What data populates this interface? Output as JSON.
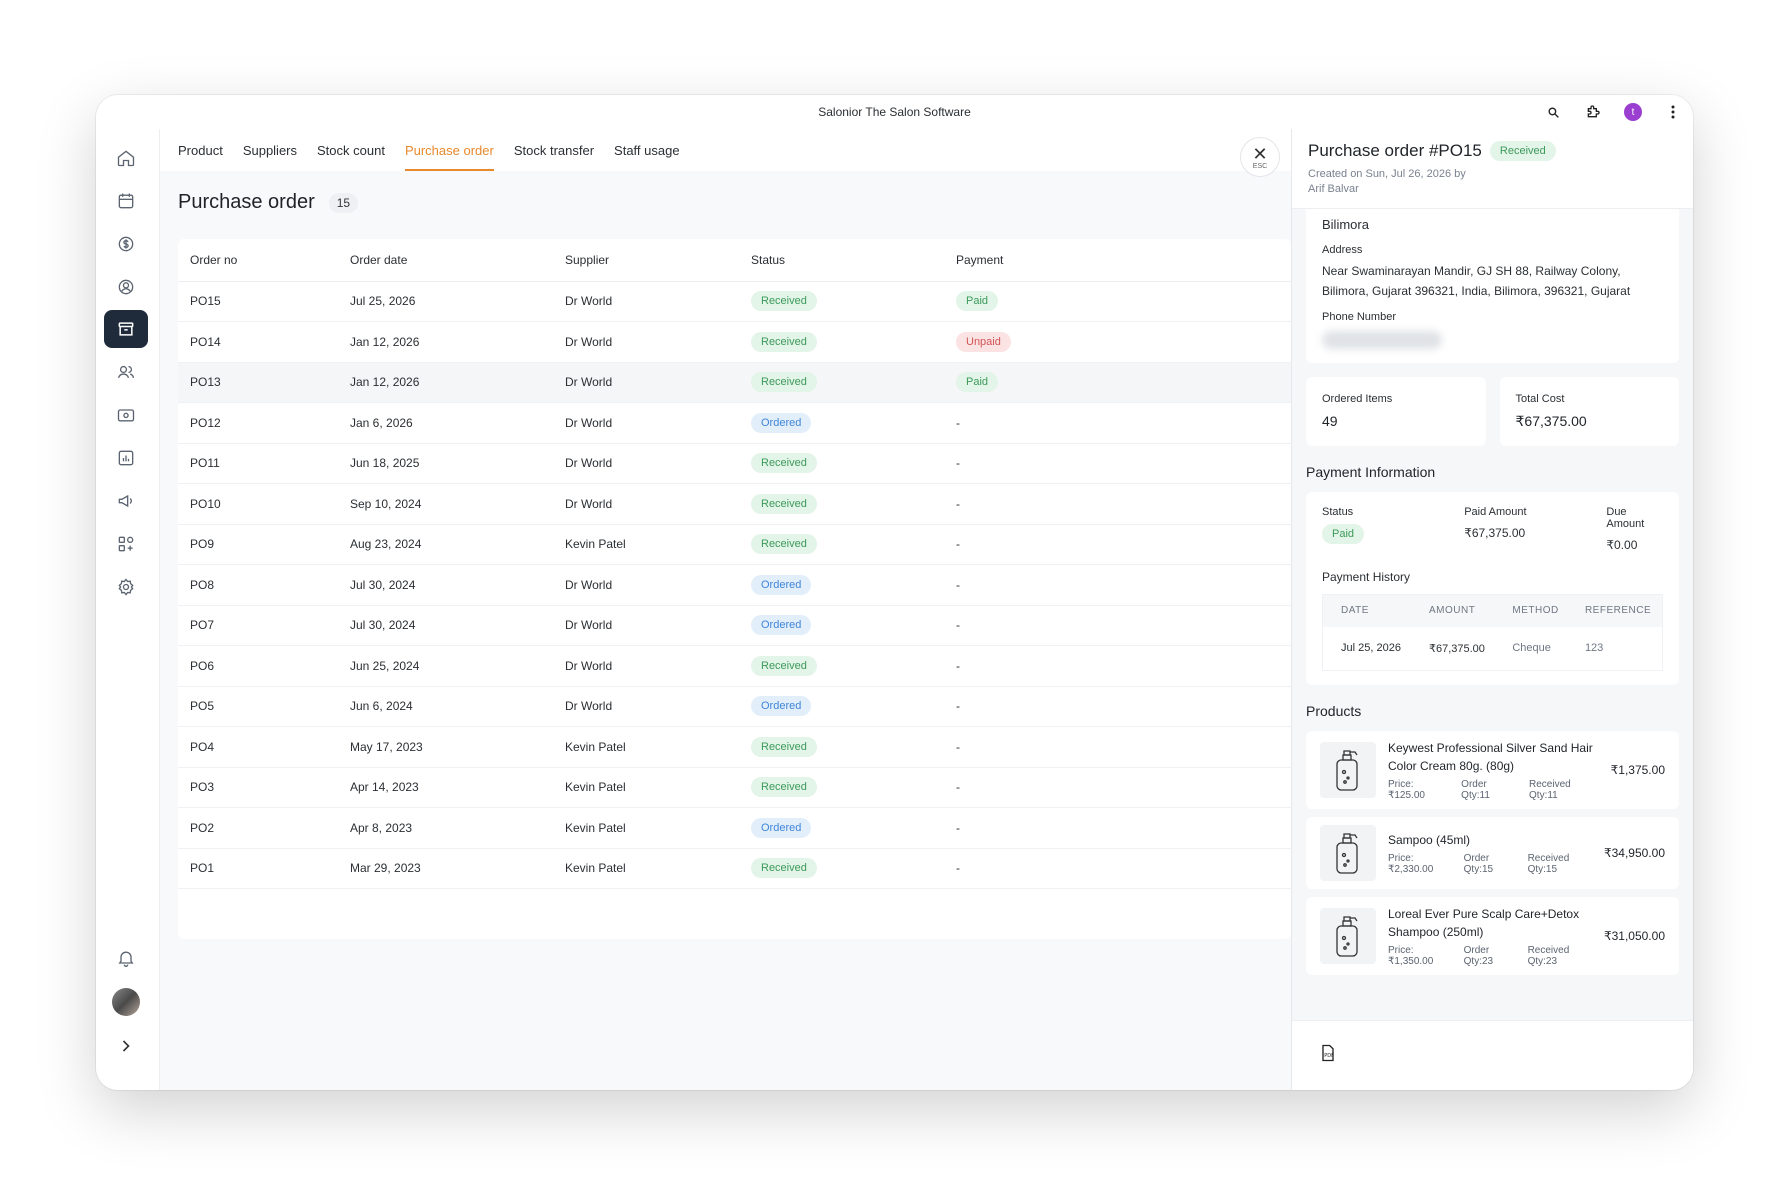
{
  "window": {
    "title": "Salonior The Salon Software"
  },
  "titlebar": {
    "avatar_letter": "t",
    "icons": [
      "search-icon",
      "extension-icon",
      "more-vertical-icon"
    ]
  },
  "sidebar": {
    "items": [
      {
        "name": "home-icon"
      },
      {
        "name": "calendar-icon"
      },
      {
        "name": "billing-icon"
      },
      {
        "name": "client-icon"
      },
      {
        "name": "inventory-icon"
      },
      {
        "name": "staff-icon"
      },
      {
        "name": "wallet-icon"
      },
      {
        "name": "reports-icon"
      },
      {
        "name": "marketing-icon"
      },
      {
        "name": "apps-icon"
      },
      {
        "name": "settings-icon"
      }
    ],
    "bottom": [
      "bell-icon",
      "user-avatar",
      "chevron-right-icon"
    ]
  },
  "tabs": [
    {
      "label": "Product",
      "active": false
    },
    {
      "label": "Suppliers",
      "active": false
    },
    {
      "label": "Stock count",
      "active": false
    },
    {
      "label": "Purchase order",
      "active": true
    },
    {
      "label": "Stock transfer",
      "active": false
    },
    {
      "label": "Staff usage",
      "active": false
    }
  ],
  "esc": {
    "label": "ESC"
  },
  "page": {
    "title": "Purchase order",
    "count": "15"
  },
  "table": {
    "columns": [
      "Order no",
      "Order date",
      "Supplier",
      "Status",
      "Payment"
    ],
    "rows": [
      {
        "order": "PO15",
        "date": "Jul 25, 2026",
        "supplier": "Dr World",
        "status": "Received",
        "payment": "Paid"
      },
      {
        "order": "PO14",
        "date": "Jan 12, 2026",
        "supplier": "Dr World",
        "status": "Received",
        "payment": "Unpaid"
      },
      {
        "order": "PO13",
        "date": "Jan 12, 2026",
        "supplier": "Dr World",
        "status": "Received",
        "payment": "Paid"
      },
      {
        "order": "PO12",
        "date": "Jan 6, 2026",
        "supplier": "Dr World",
        "status": "Ordered",
        "payment": "-"
      },
      {
        "order": "PO11",
        "date": "Jun 18, 2025",
        "supplier": "Dr World",
        "status": "Received",
        "payment": "-"
      },
      {
        "order": "PO10",
        "date": "Sep 10, 2024",
        "supplier": "Dr World",
        "status": "Received",
        "payment": "-"
      },
      {
        "order": "PO9",
        "date": "Aug 23, 2024",
        "supplier": "Kevin Patel",
        "status": "Received",
        "payment": "-"
      },
      {
        "order": "PO8",
        "date": "Jul 30, 2024",
        "supplier": "Dr World",
        "status": "Ordered",
        "payment": "-"
      },
      {
        "order": "PO7",
        "date": "Jul 30, 2024",
        "supplier": "Dr World",
        "status": "Ordered",
        "payment": "-"
      },
      {
        "order": "PO6",
        "date": "Jun 25, 2024",
        "supplier": "Dr World",
        "status": "Received",
        "payment": "-"
      },
      {
        "order": "PO5",
        "date": "Jun 6, 2024",
        "supplier": "Dr World",
        "status": "Ordered",
        "payment": "-"
      },
      {
        "order": "PO4",
        "date": "May 17, 2023",
        "supplier": "Kevin Patel",
        "status": "Received",
        "payment": "-"
      },
      {
        "order": "PO3",
        "date": "Apr 14, 2023",
        "supplier": "Kevin Patel",
        "status": "Received",
        "payment": "-"
      },
      {
        "order": "PO2",
        "date": "Apr 8, 2023",
        "supplier": "Kevin Patel",
        "status": "Ordered",
        "payment": "-"
      },
      {
        "order": "PO1",
        "date": "Mar 29, 2023",
        "supplier": "Kevin Patel",
        "status": "Received",
        "payment": "-"
      }
    ]
  },
  "panel": {
    "title": "Purchase order #PO15",
    "status": "Received",
    "created_line1": "Created on Sun, Jul 26, 2026 by",
    "created_line2": "Arif Balvar",
    "supplier_city": "Bilimora",
    "address_label": "Address",
    "address": "Near Swaminarayan Mandir, GJ SH 88, Railway Colony, Bilimora, Gujarat 396321, India, Bilimora, 396321, Gujarat",
    "phone_label": "Phone Number",
    "ordered_items_label": "Ordered Items",
    "ordered_items": "49",
    "total_cost_label": "Total Cost",
    "total_cost": "₹67,375.00",
    "payment_info_title": "Payment Information",
    "status_label": "Status",
    "payment_status": "Paid",
    "paid_amount_label": "Paid Amount",
    "paid_amount": "₹67,375.00",
    "due_amount_label": "Due Amount",
    "due_amount": "₹0.00",
    "payment_history_title": "Payment History",
    "history_columns": [
      "DATE",
      "AMOUNT",
      "METHOD",
      "REFERENCE"
    ],
    "history_rows": [
      {
        "date": "Jul 25, 2026",
        "amount": "₹67,375.00",
        "method": "Cheque",
        "reference": "123"
      }
    ],
    "products_title": "Products",
    "products": [
      {
        "name": "Keywest Professional Silver Sand Hair Color Cream 80g. (80g)",
        "price": "Price:₹125.00",
        "order_qty": "Order Qty:11",
        "received_qty": "Received Qty:11",
        "total": "₹1,375.00"
      },
      {
        "name": "Sampoo (45ml)",
        "price": "Price:₹2,330.00",
        "order_qty": "Order Qty:15",
        "received_qty": "Received Qty:15",
        "total": "₹34,950.00"
      },
      {
        "name": "Loreal Ever Pure Scalp Care+Detox Shampoo (250ml)",
        "price": "Price:₹1,350.00",
        "order_qty": "Order Qty:23",
        "received_qty": "Received Qty:23",
        "total": "₹31,050.00"
      }
    ],
    "footer_icon": "pdf-icon"
  }
}
